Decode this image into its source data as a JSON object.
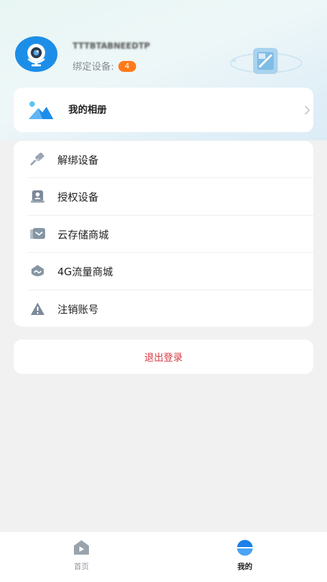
{
  "profile": {
    "username": "TTTBTABNEEDTP",
    "bound_label": "绑定设备:",
    "bound_count": "4"
  },
  "album": {
    "label": "我的相册"
  },
  "menu": {
    "items": [
      {
        "label": "解绑设备",
        "icon": "unlink-icon"
      },
      {
        "label": "授权设备",
        "icon": "authorize-user-icon"
      },
      {
        "label": "云存储商城",
        "icon": "cloud-storage-icon"
      },
      {
        "label": "4G流量商城",
        "icon": "4g-traffic-icon"
      },
      {
        "label": "注销账号",
        "icon": "warning-icon"
      }
    ]
  },
  "logout": {
    "label": "退出登录"
  },
  "tabbar": {
    "tabs": [
      {
        "label": "首页",
        "active": false
      },
      {
        "label": "我的",
        "active": true
      }
    ]
  },
  "colors": {
    "accent": "#1d8ee8",
    "badge": "#ff7a1a",
    "logout": "#d9363e",
    "background": "#f1f1f1"
  }
}
